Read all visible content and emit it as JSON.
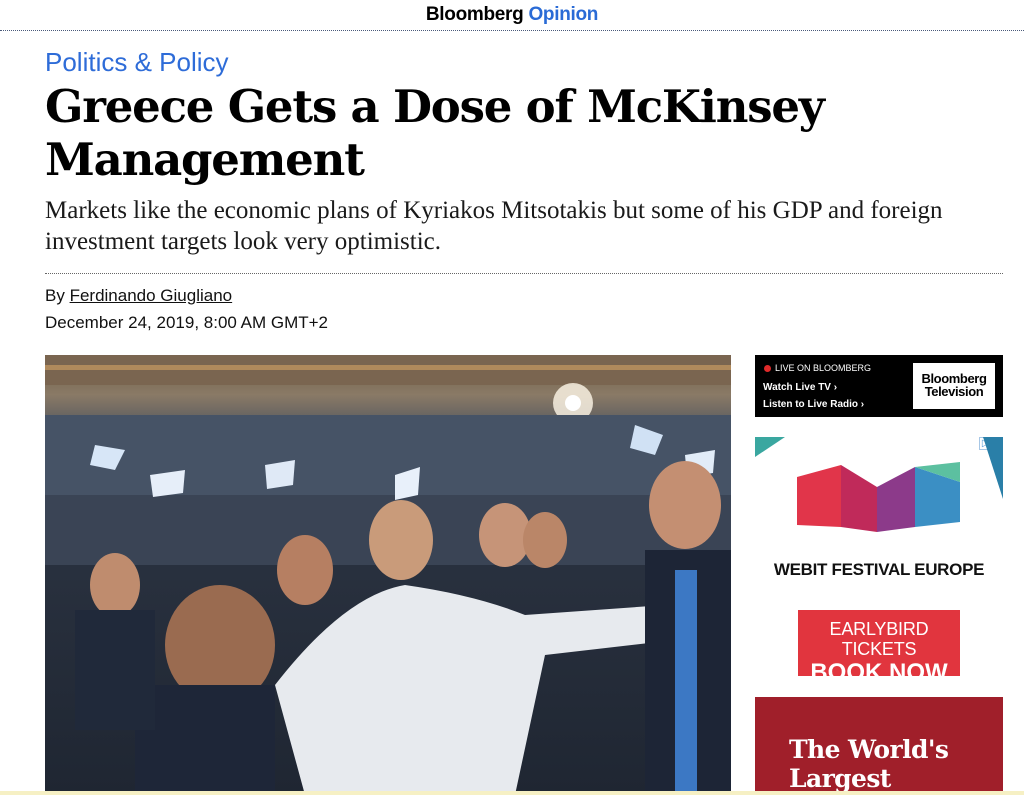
{
  "masthead": {
    "brand_main": "Bloomberg",
    "brand_sub": "Opinion"
  },
  "article": {
    "kicker": "Politics & Policy",
    "headline": "Greece Gets a Dose of McKinsey Management",
    "dek": "Markets like the economic plans of Kyriakos Mitsotakis but some of his GDP and foreign investment targets look very optimistic.",
    "byline_prefix": "By",
    "author": "Ferdinando Giugliano",
    "dateline": "December 24, 2019, 8:00 AM GMT+2"
  },
  "live_promo": {
    "label": "LIVE ON BLOOMBERG",
    "link_tv": "Watch Live TV",
    "link_radio": "Listen to Live Radio",
    "logo_line1": "Bloomberg",
    "logo_line2": "Television"
  },
  "ad": {
    "close_glyph": "▷✕",
    "title": "WEBIT FESTIVAL EUROPE",
    "cta_line1": "EARLYBIRD TICKETS",
    "cta_line2": "BOOK NOW",
    "promo_text": "The World's Largest"
  },
  "colors": {
    "brand_blue": "#2a6bd6",
    "kicker_blue": "#2e6cd8",
    "cta_red": "#e1353e",
    "promo_dark_red": "#a01f2a"
  }
}
